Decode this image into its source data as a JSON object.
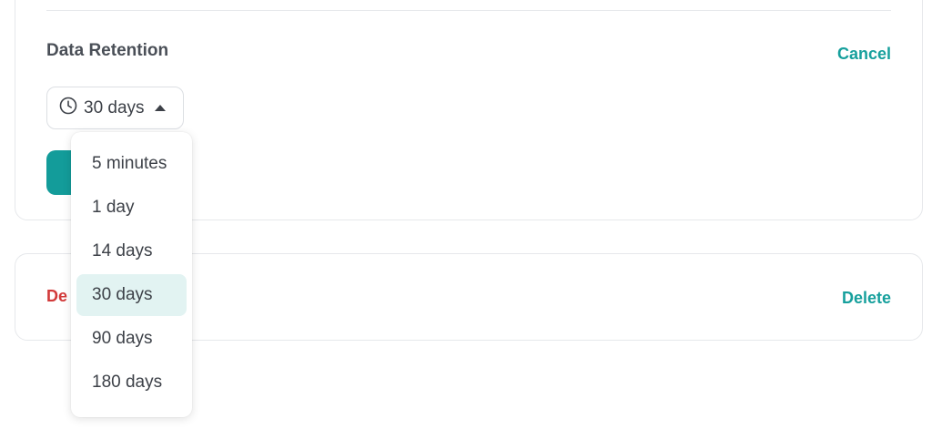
{
  "retention": {
    "title": "Data Retention",
    "cancel_label": "Cancel",
    "selected_value": "30 days",
    "clock_icon": "clock-icon",
    "caret_icon": "caret-up-icon",
    "options": [
      "5 minutes",
      "1 day",
      "14 days",
      "30 days",
      "90 days",
      "180 days"
    ],
    "selected_index": 3
  },
  "danger": {
    "label_visible": "De",
    "delete_label": "Delete"
  },
  "colors": {
    "accent": "#17a09d",
    "button_fill": "#139c9a",
    "danger": "#d23a3a",
    "selected_bg": "#e2f3f2"
  }
}
